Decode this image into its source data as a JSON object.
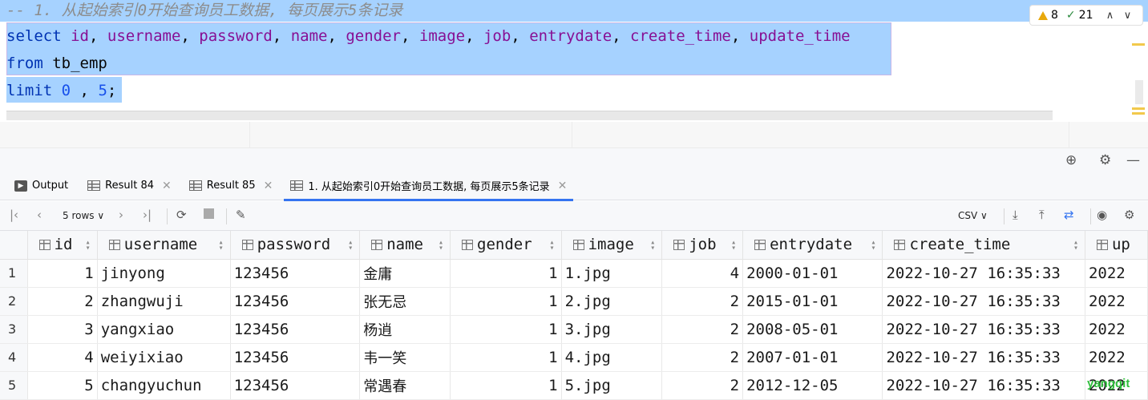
{
  "editor": {
    "comment": "-- 1. 从起始索引0开始查询员工数据, 每页展示5条记录",
    "line2": {
      "keyword": "select",
      "columns": [
        "id",
        "username",
        "password",
        "name",
        "gender",
        "image",
        "job",
        "entrydate",
        "create_time",
        "update_time"
      ]
    },
    "line3": {
      "keyword": "from",
      "table": "tb_emp"
    },
    "line4": {
      "keyword": "limit",
      "offset": "0",
      "sep": " , ",
      "count": "5",
      "end": ";"
    },
    "inspection": {
      "warnings": "8",
      "weak_warnings": "21"
    }
  },
  "tabs": [
    {
      "label": "Output",
      "icon": "output-icon",
      "closable": false
    },
    {
      "label": "Result 84",
      "icon": "grid-icon",
      "closable": true
    },
    {
      "label": "Result 85",
      "icon": "grid-icon",
      "closable": true
    },
    {
      "label": "1. 从起始索引0开始查询员工数据, 每页展示5条记录",
      "icon": "grid-icon",
      "closable": true,
      "active": true
    }
  ],
  "toolbar": {
    "rows_label": "5 rows",
    "export_format": "CSV"
  },
  "grid": {
    "columns": [
      "id",
      "username",
      "password",
      "name",
      "gender",
      "image",
      "job",
      "entrydate",
      "create_time",
      "up"
    ],
    "rows": [
      [
        "1",
        "1",
        "jinyong",
        "123456",
        "金庸",
        "1",
        "1.jpg",
        "4",
        "2000-01-01",
        "2022-10-27 16:35:33",
        "2022"
      ],
      [
        "2",
        "2",
        "zhangwuji",
        "123456",
        "张无忌",
        "1",
        "2.jpg",
        "2",
        "2015-01-01",
        "2022-10-27 16:35:33",
        "2022"
      ],
      [
        "3",
        "3",
        "yangxiao",
        "123456",
        "杨逍",
        "1",
        "3.jpg",
        "2",
        "2008-05-01",
        "2022-10-27 16:35:33",
        "2022"
      ],
      [
        "4",
        "4",
        "weiyixiao",
        "123456",
        "韦一笑",
        "1",
        "4.jpg",
        "2",
        "2007-01-01",
        "2022-10-27 16:35:33",
        "2022"
      ],
      [
        "5",
        "5",
        "changyuchun",
        "123456",
        "常遇春",
        "1",
        "5.jpg",
        "2",
        "2012-12-05",
        "2022-10-27 16:35:33",
        "2022"
      ]
    ]
  },
  "watermark": "yangqit",
  "colors": {
    "selection": "#a6d2ff",
    "keyword": "#0033b3",
    "column": "#871094",
    "number": "#1750eb",
    "accent": "#3574f0"
  }
}
